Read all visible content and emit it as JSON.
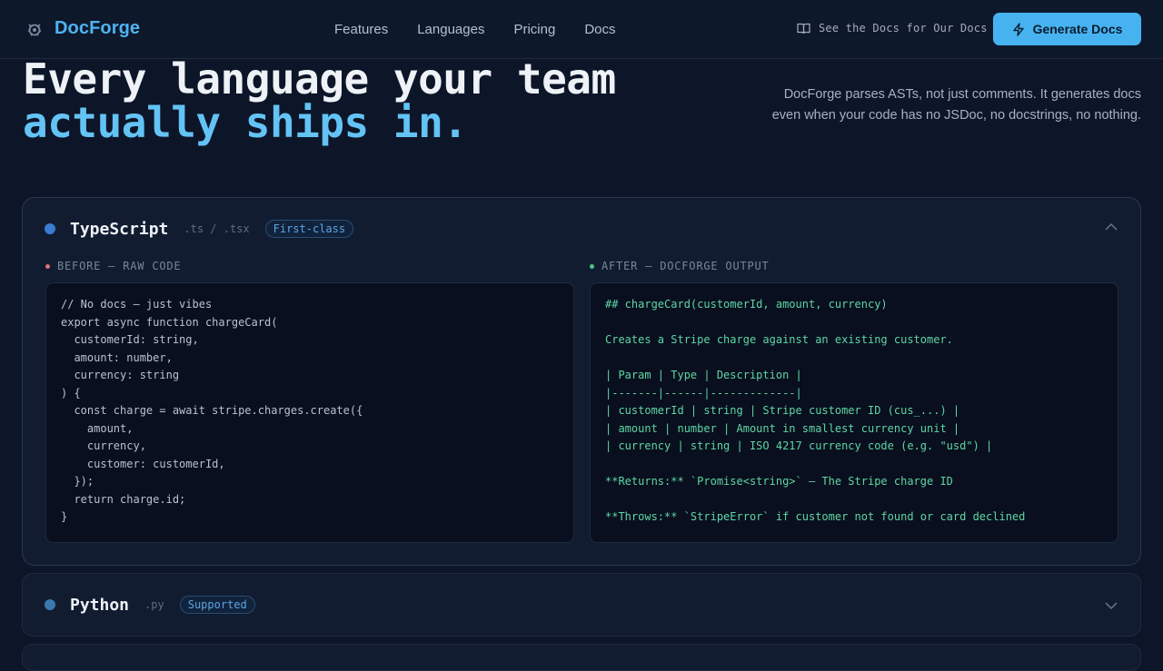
{
  "nav": {
    "brand": "DocForge",
    "links": [
      "Features",
      "Languages",
      "Pricing",
      "Docs"
    ],
    "see_docs": "See the Docs for Our Docs",
    "cta": "Generate Docs"
  },
  "hero": {
    "line1": "Every language your team",
    "line2": "actually ships in.",
    "description": "DocForge parses ASTs, not just comments. It generates docs even when your code has no JSDoc, no docstrings, no nothing."
  },
  "languages": [
    {
      "name": "TypeScript",
      "ext": ".ts / .tsx",
      "badge": "First-class",
      "dot_color": "#3b7bd4",
      "expanded": true,
      "before_label": "BEFORE — RAW CODE",
      "after_label": "AFTER — DOCFORGE OUTPUT",
      "before_code": "// No docs — just vibes\nexport async function chargeCard(\n  customerId: string,\n  amount: number,\n  currency: string\n) {\n  const charge = await stripe.charges.create({\n    amount,\n    currency,\n    customer: customerId,\n  });\n  return charge.id;\n}",
      "after_code": "## chargeCard(customerId, amount, currency)\n\nCreates a Stripe charge against an existing customer.\n\n| Param | Type | Description |\n|-------|------|-------------|\n| customerId | string | Stripe customer ID (cus_...) |\n| amount | number | Amount in smallest currency unit |\n| currency | string | ISO 4217 currency code (e.g. \"usd\") |\n\n**Returns:** `Promise<string>` — The Stripe charge ID\n\n**Throws:** `StripeError` if customer not found or card declined"
    },
    {
      "name": "Python",
      "ext": ".py",
      "badge": "Supported",
      "dot_color": "#3a79b0",
      "expanded": false
    }
  ],
  "colors": {
    "accent": "#46b3f0",
    "before_dot": "#e0707a",
    "after_dot": "#4fc48a"
  }
}
